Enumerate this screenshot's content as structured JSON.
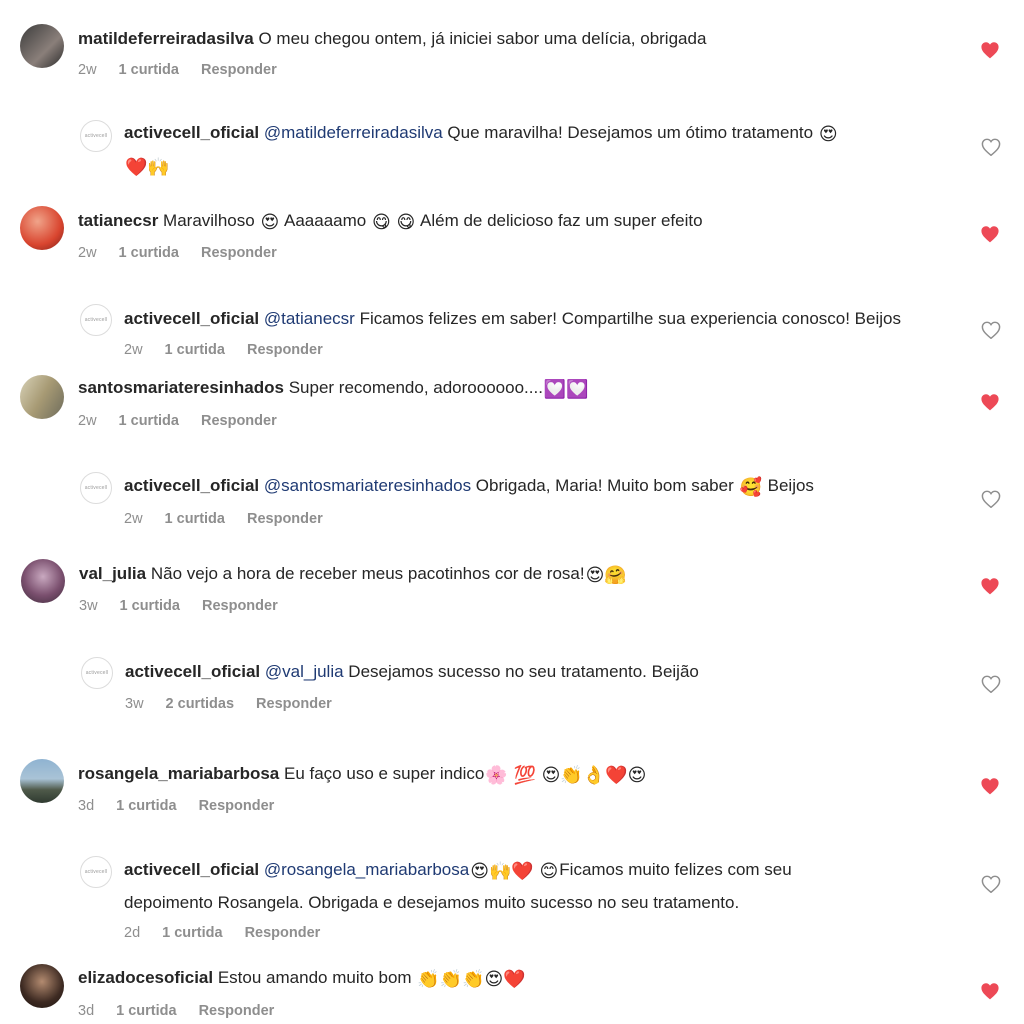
{
  "comments": [
    {
      "user": "matildeferreiradasilva",
      "text": " O meu chegou ontem, já iniciei sabor uma delícia, obrigada",
      "time": "2w",
      "likes": "1 curtida",
      "reply": "Responder",
      "liked": true
    },
    {
      "user": "activecell_oficial",
      "mention": "@matildeferreiradasilva",
      "text": " Que maravilha! Desejamos um ótimo tratamento ",
      "emojis_1": "😍",
      "emojis_2": "❤️🙌",
      "liked": false
    },
    {
      "user": "tatianecsr",
      "text_a": " Maravilhoso ",
      "emoji_a": "😍",
      "text_b": " Aaaaaamo ",
      "emoji_b": "😋 😋",
      "text_c": " Além de delicioso faz um super efeito",
      "time": "2w",
      "likes": "1 curtida",
      "reply": "Responder",
      "liked": true
    },
    {
      "user": "activecell_oficial",
      "mention": "@tatianecsr",
      "text": " Ficamos felizes em saber! Compartilhe sua experiencia conosco! Beijos",
      "time": "2w",
      "likes": "1 curtida",
      "reply": "Responder",
      "liked": false
    },
    {
      "user": "santosmariateresinhados",
      "text": " Super recomendo, adoroooooo....",
      "emojis": "💟💟",
      "time": "2w",
      "likes": "1 curtida",
      "reply": "Responder",
      "liked": true
    },
    {
      "user": "activecell_oficial",
      "mention": "@santosmariateresinhados",
      "text": " Obrigada, Maria! Muito bom saber ",
      "emojis": "🥰",
      "text_end": " Beijos",
      "time": "2w",
      "likes": "1 curtida",
      "reply": "Responder",
      "liked": false
    },
    {
      "user": "val_julia",
      "text": " Não vejo a hora de receber meus pacotinhos cor de rosa!",
      "emojis": "😍🤗",
      "time": "3w",
      "likes": "1 curtida",
      "reply": "Responder",
      "liked": true
    },
    {
      "user": "activecell_oficial",
      "mention": "@val_julia",
      "text": " Desejamos sucesso no seu tratamento. Beijão",
      "time": "3w",
      "likes": "2 curtidas",
      "reply": "Responder",
      "liked": false
    },
    {
      "user": "rosangela_mariabarbosa",
      "text": " Eu faço uso e super indico",
      "emojis": "🌸 💯 😍👏👌❤️😍",
      "time": "3d",
      "likes": "1 curtida",
      "reply": "Responder",
      "liked": true
    },
    {
      "user": "activecell_oficial",
      "mention": "@rosangela_mariabarbosa",
      "emojis": " 😍🙌❤️ 😊 ",
      "text": "Ficamos muito felizes com seu",
      "text_line2": "depoimento Rosangela. Obrigada e desejamos muito sucesso no seu tratamento.",
      "time": "2d",
      "likes": "1 curtida",
      "reply": "Responder",
      "liked": false
    },
    {
      "user": "elizadocesoficial",
      "text": " Estou amando muito bom ",
      "emojis": "👏👏👏😍❤️",
      "time": "3d",
      "likes": "1 curtida",
      "reply": "Responder",
      "liked": true
    }
  ],
  "colors": {
    "heart_liked": "#ed4956",
    "heart_outline": "#8e8e8e",
    "mention": "#1f3a73",
    "meta": "#8e8e8e"
  },
  "icons": {
    "liked": "heart-filled-icon",
    "not_liked": "heart-outline-icon"
  }
}
